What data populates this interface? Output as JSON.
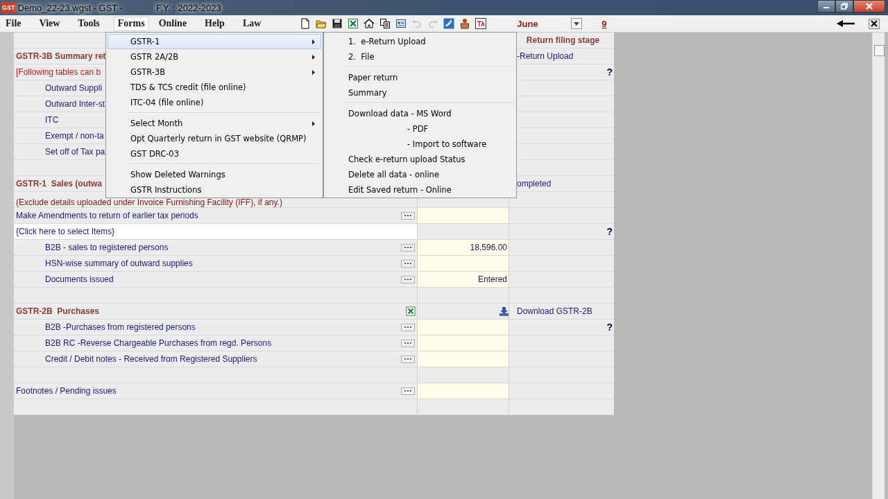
{
  "window": {
    "app_icon_text": "GST",
    "title": "Demo_22-23.wgst - GST -",
    "fy": "F.Y. : 2022-2023"
  },
  "menubar": [
    {
      "label": "File",
      "selected": false
    },
    {
      "label": "View",
      "selected": false
    },
    {
      "label": "Tools",
      "selected": false
    },
    {
      "label": "Forms",
      "selected": true
    },
    {
      "label": "Online",
      "selected": false
    },
    {
      "label": "Help",
      "selected": false
    },
    {
      "label": "Law",
      "selected": false
    }
  ],
  "toolbar": [
    {
      "disabled": false
    },
    {
      "disabled": false
    },
    {
      "disabled": false
    },
    {
      "disabled": false
    },
    {
      "disabled": false
    },
    {
      "disabled": false
    },
    {
      "disabled": false
    },
    {
      "disabled": true
    },
    {
      "disabled": true
    },
    {
      "disabled": false
    },
    {
      "disabled": false
    },
    {
      "disabled": false
    }
  ],
  "month": {
    "value": "June"
  },
  "day": "9",
  "grid": {
    "rows": [
      {
        "kind": "header",
        "col3": "Return filing stage"
      },
      {
        "kind": "section",
        "label": "GSTR-3B Summary ret",
        "col3": "-Return Upload"
      },
      {
        "kind": "warning",
        "label": "[Following tables can b",
        "help": "?"
      },
      {
        "kind": "subitem",
        "label": "Outward Suppli"
      },
      {
        "kind": "subitem",
        "label": "Outward Inter-st"
      },
      {
        "kind": "subitem",
        "label": "ITC"
      },
      {
        "kind": "subitem",
        "label": "Exempt / non-ta"
      },
      {
        "kind": "subitem",
        "label": "Set off of Tax pa"
      },
      {
        "kind": "blank"
      },
      {
        "kind": "section",
        "label": "GSTR-1  Sales (outwa",
        "col3": "ompleted"
      },
      {
        "kind": "note",
        "label": "(Exclude details uploaded under Invoice Furnishing Facility (IFF), if any.)"
      },
      {
        "kind": "item",
        "label": "Make Amendments to return of earlier tax periods",
        "more": true,
        "input": true
      },
      {
        "kind": "select",
        "label": "{Click here to select Items}",
        "help": "?"
      },
      {
        "kind": "subitem",
        "label": "B2B - sales to registered persons",
        "more": true,
        "input": true,
        "value": "18,596.00"
      },
      {
        "kind": "subitem",
        "label": "HSN-wise summary of outward supplies",
        "more": true,
        "input": true
      },
      {
        "kind": "subitem",
        "label": "Documents issued",
        "more": true,
        "input": true,
        "value": "Entered"
      },
      {
        "kind": "blank"
      },
      {
        "kind": "section",
        "label": "GSTR-2B  Purchases",
        "excel": true,
        "download": true,
        "col3": "Download GSTR-2B"
      },
      {
        "kind": "subitem",
        "label": "B2B -Purchases from registered persons",
        "more": true,
        "input": true,
        "help": "?"
      },
      {
        "kind": "subitem",
        "label": "B2B RC -Reverse Chargeable Purchases from regd. Persons",
        "more": true,
        "input": true
      },
      {
        "kind": "subitem",
        "label": "Credit / Debit notes - Received from Registered Suppliers",
        "more": true,
        "input": true
      },
      {
        "kind": "blank"
      },
      {
        "kind": "item",
        "label": "Footnotes / Pending issues",
        "more": true,
        "input": true
      },
      {
        "kind": "blank"
      }
    ]
  },
  "forms_menu": {
    "items": [
      {
        "kind": "item",
        "label": "GSTR-1",
        "submenu": true,
        "selected": true
      },
      {
        "kind": "item",
        "label": "GSTR 2A/2B",
        "submenu": true,
        "selected": false
      },
      {
        "kind": "item",
        "label": "GSTR-3B",
        "submenu": true,
        "selected": false
      },
      {
        "kind": "item",
        "label": "TDS & TCS credit (file online)",
        "submenu": false,
        "selected": false
      },
      {
        "kind": "item",
        "label": "ITC-04 (file online)",
        "submenu": false,
        "selected": false
      },
      {
        "kind": "separator"
      },
      {
        "kind": "item",
        "label": "Select Month",
        "submenu": true,
        "selected": false
      },
      {
        "kind": "item",
        "label": "Opt Quarterly return in GST website (QRMP)",
        "submenu": false,
        "selected": false
      },
      {
        "kind": "item",
        "label": "GST DRC-03",
        "submenu": false,
        "selected": false
      },
      {
        "kind": "separator"
      },
      {
        "kind": "item",
        "label": "Show Deleted Warnings",
        "submenu": false,
        "selected": false
      },
      {
        "kind": "item",
        "label": "GSTR Instructions",
        "submenu": false,
        "selected": false
      }
    ]
  },
  "gstr1_submenu": {
    "items": [
      {
        "kind": "item",
        "label": "1.  e-Return Upload"
      },
      {
        "kind": "item",
        "label": "2.  File"
      },
      {
        "kind": "separator"
      },
      {
        "kind": "item",
        "label": "Paper return"
      },
      {
        "kind": "item",
        "label": "Summary"
      },
      {
        "kind": "separator"
      },
      {
        "kind": "item",
        "label": "Download data - MS Word"
      },
      {
        "kind": "indented",
        "label": "- PDF"
      },
      {
        "kind": "indented",
        "label": "- Import to software"
      },
      {
        "kind": "item",
        "label": "Check e-return upload Status"
      },
      {
        "kind": "item",
        "label": "Delete all data - online"
      },
      {
        "kind": "item",
        "label": "Edit Saved return - Online"
      }
    ]
  }
}
